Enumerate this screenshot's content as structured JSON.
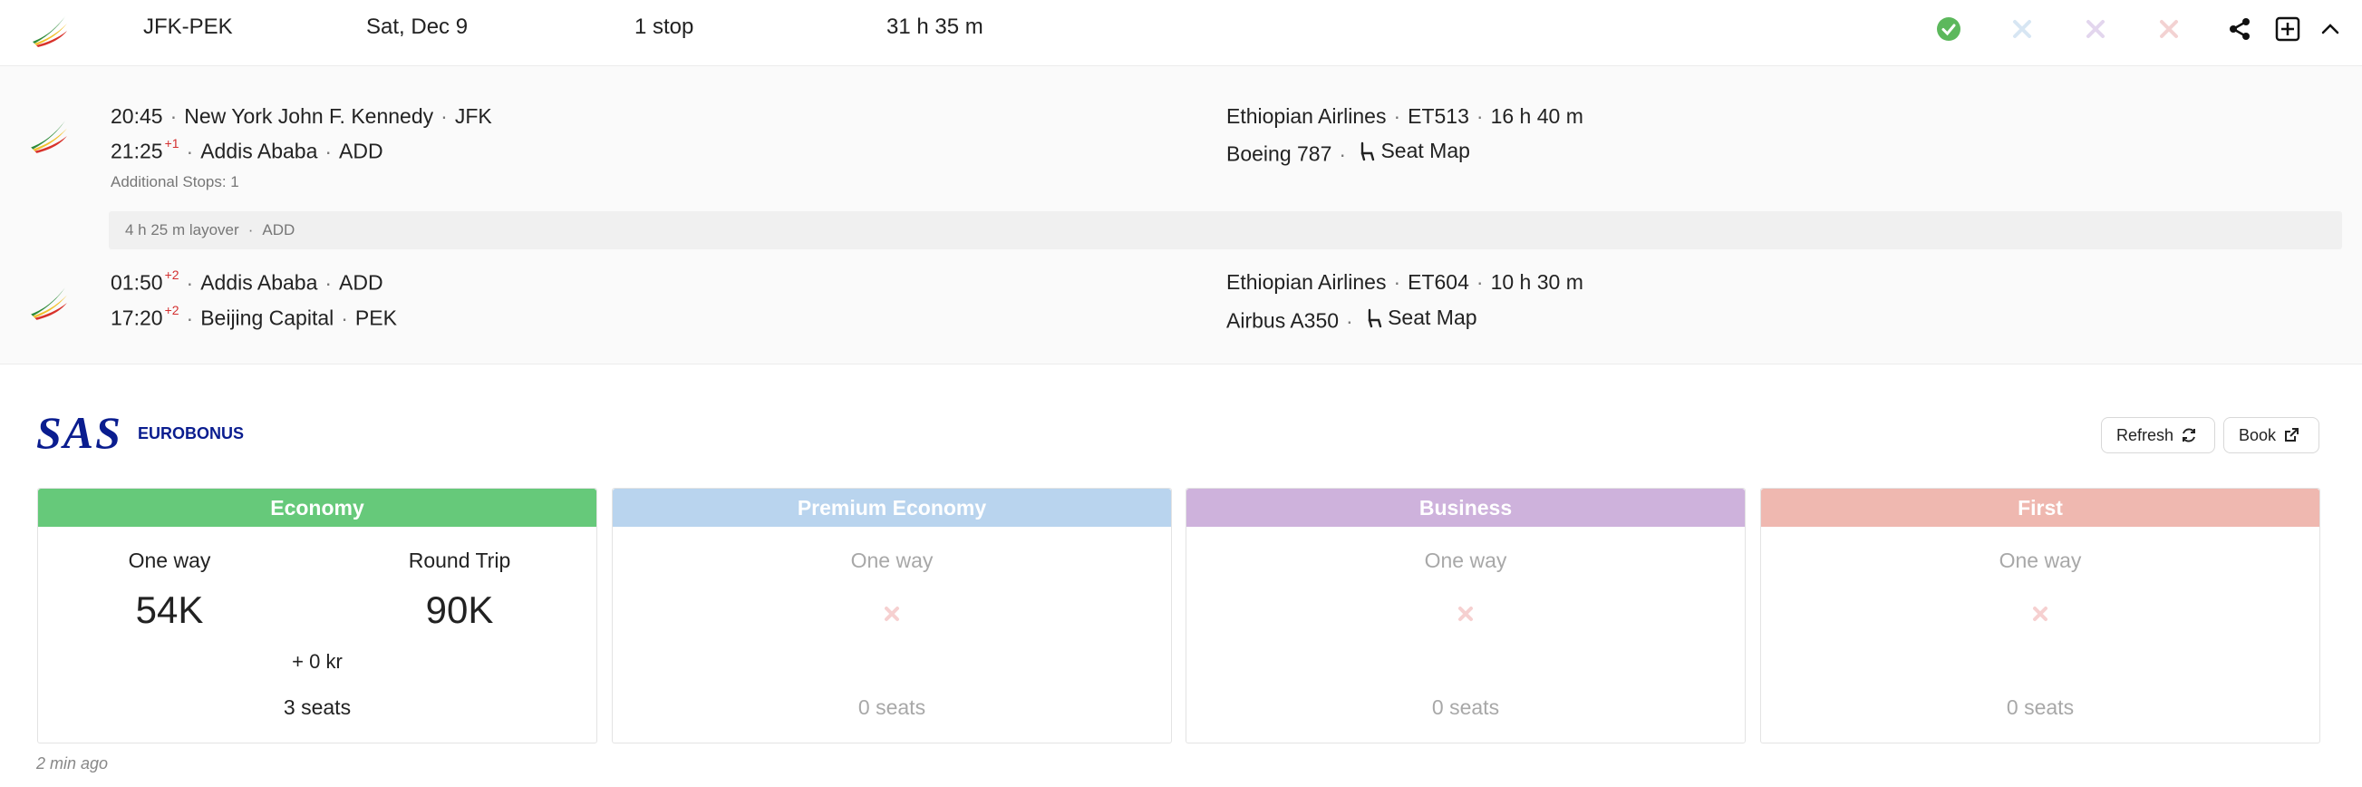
{
  "summary": {
    "route": "JFK-PEK",
    "date": "Sat, Dec 9",
    "stops": "1 stop",
    "duration": "31 h 35 m"
  },
  "icons": {
    "status": [
      "check-icon",
      "x-icon",
      "x-icon",
      "x-icon"
    ],
    "status_colors": [
      "#5cb85c",
      "#d7e6f3",
      "#e3d6ee",
      "#f3d2d2"
    ],
    "actions": [
      "share-icon",
      "expand-box-icon",
      "chevron-up-icon"
    ]
  },
  "segments": [
    {
      "dep_time": "20:45",
      "dep_sup": "",
      "dep_city": "New York John F. Kennedy",
      "dep_code": "JFK",
      "arr_time": "21:25",
      "arr_sup": "+1",
      "arr_city": "Addis Ababa",
      "arr_code": "ADD",
      "airline": "Ethiopian Airlines",
      "flight": "ET513",
      "flight_duration": "16 h 40 m",
      "aircraft": "Boeing 787",
      "seat_map": "Seat Map",
      "note": "Additional Stops: 1"
    },
    {
      "dep_time": "01:50",
      "dep_sup": "+2",
      "dep_city": "Addis Ababa",
      "dep_code": "ADD",
      "arr_time": "17:20",
      "arr_sup": "+2",
      "arr_city": "Beijing Capital",
      "arr_code": "PEK",
      "airline": "Ethiopian Airlines",
      "flight": "ET604",
      "flight_duration": "10 h 30 m",
      "aircraft": "Airbus A350",
      "seat_map": "Seat Map",
      "note": ""
    }
  ],
  "layover": {
    "duration": "4 h 25 m layover",
    "airport": "ADD"
  },
  "program": {
    "logo_text": "SAS",
    "logo_sub": "EUROBONUS",
    "refresh_label": "Refresh",
    "book_label": "Book",
    "updated": "2 min ago"
  },
  "cabins": [
    {
      "name": "Economy",
      "color": "#66c97a",
      "available": true,
      "one_way_label": "One way",
      "round_trip_label": "Round Trip",
      "one_way_value": "54K",
      "round_trip_value": "90K",
      "fee": "+ 0 kr",
      "seats": "3 seats"
    },
    {
      "name": "Premium Economy",
      "color": "#b9d4ee",
      "available": false,
      "one_way_label": "One way",
      "seats": "0 seats"
    },
    {
      "name": "Business",
      "color": "#ceb2dc",
      "available": false,
      "one_way_label": "One way",
      "seats": "0 seats"
    },
    {
      "name": "First",
      "color": "#efb8b0",
      "available": false,
      "one_way_label": "One way",
      "seats": "0 seats"
    }
  ]
}
